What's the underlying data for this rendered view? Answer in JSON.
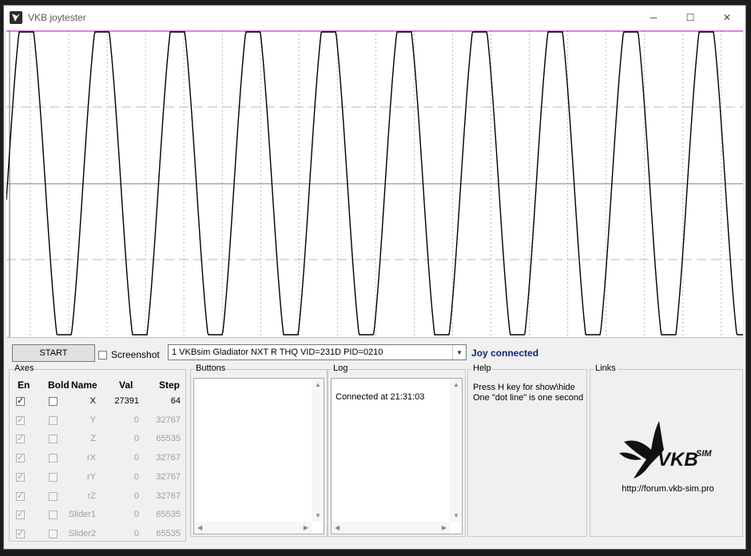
{
  "window": {
    "title": "VKB joytester"
  },
  "titlebar": {
    "minimize": "─",
    "maximize": "☐",
    "close": "✕"
  },
  "toolbar": {
    "start_label": "START",
    "screenshot_label": "Screenshot",
    "screenshot_checked": false,
    "device_value": "1  VKBsim Gladiator NXT R THQ  VID=231D PID=0210",
    "status_text": "Joy connected",
    "status_color": "#0b2878"
  },
  "axes": {
    "title": "Axes",
    "headers": {
      "en": "En",
      "bold": "Bold",
      "name": "Name",
      "val": "Val",
      "step": "Step"
    },
    "rows": [
      {
        "name": "X",
        "val": "27391",
        "step": "64",
        "enabled": true,
        "disabled": false
      },
      {
        "name": "Y",
        "val": "0",
        "step": "32767",
        "enabled": true,
        "disabled": true
      },
      {
        "name": "Z",
        "val": "0",
        "step": "65535",
        "enabled": true,
        "disabled": true
      },
      {
        "name": "rX",
        "val": "0",
        "step": "32767",
        "enabled": true,
        "disabled": true
      },
      {
        "name": "rY",
        "val": "0",
        "step": "32767",
        "enabled": true,
        "disabled": true
      },
      {
        "name": "rZ",
        "val": "0",
        "step": "32767",
        "enabled": true,
        "disabled": true
      },
      {
        "name": "Slider1",
        "val": "0",
        "step": "65535",
        "enabled": true,
        "disabled": true
      },
      {
        "name": "Slider2",
        "val": "0",
        "step": "65535",
        "enabled": true,
        "disabled": true
      }
    ]
  },
  "buttons_panel": {
    "title": "Buttons"
  },
  "log": {
    "title": "Log",
    "entries": [
      "Connected at 21:31:03"
    ]
  },
  "help": {
    "title": "Help",
    "lines": [
      "Press H key for show\\hide",
      "One \"dot line\" is one second"
    ]
  },
  "links": {
    "title": "Links",
    "logo_text": "VKBSIM",
    "url": "http://forum.vkb-sim.pro"
  },
  "graph": {
    "trace_color": "#000000",
    "top_line_color": "#d000d0",
    "grid_color": "#b8b8b8",
    "seconds_shown": 19,
    "periods_shown": 9.75
  }
}
